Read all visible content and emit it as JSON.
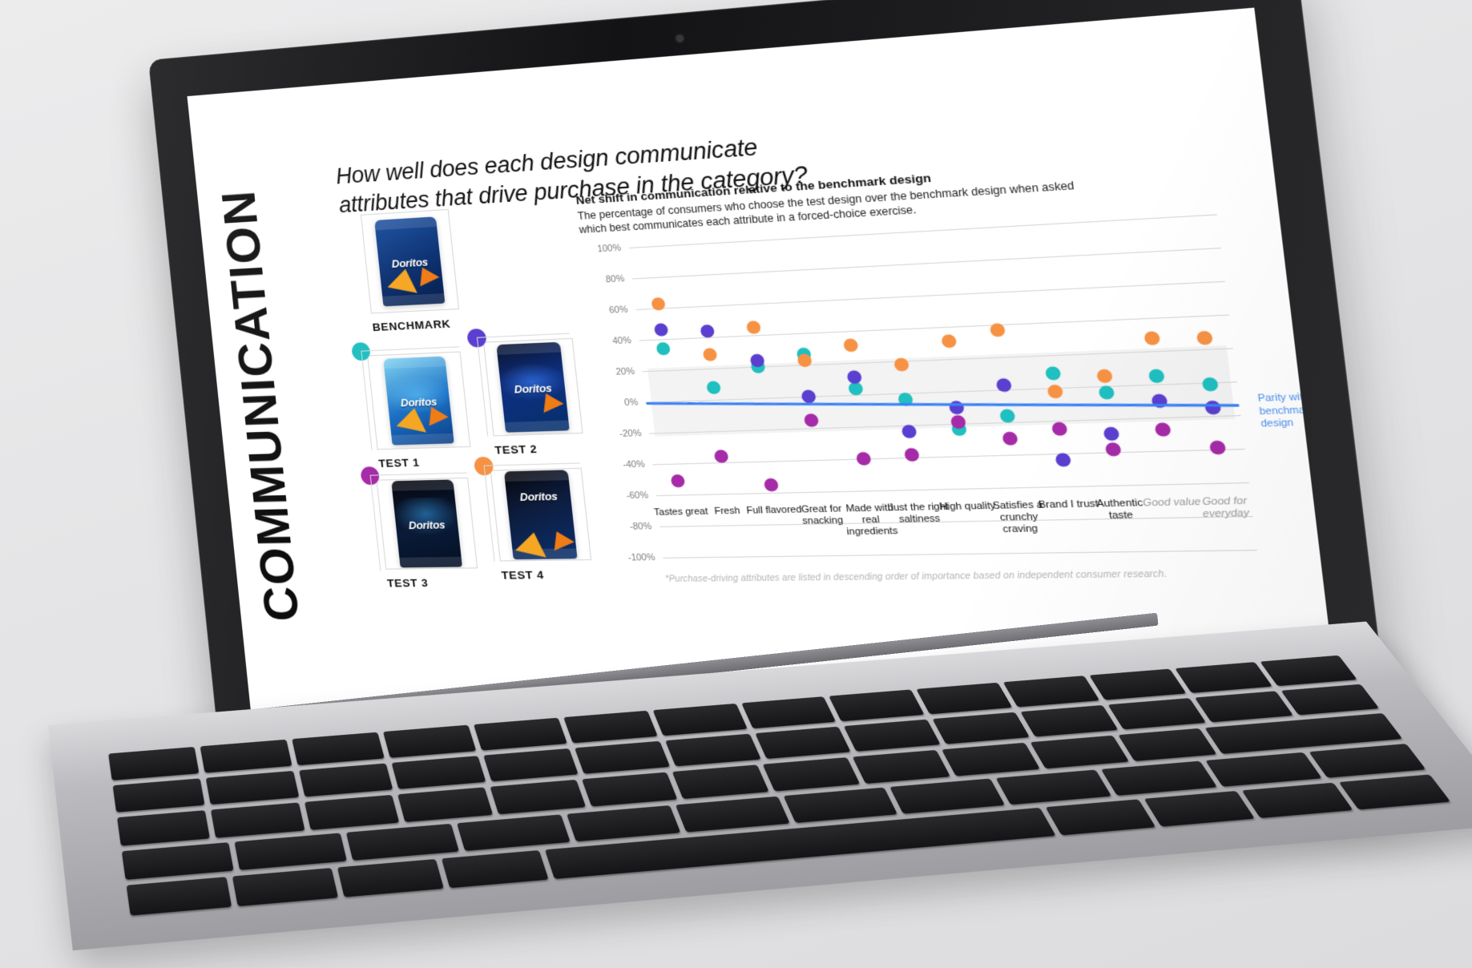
{
  "slide": {
    "vertical_title": "COMMUNICATION",
    "headline": "How well does each design communicate attributes that drive purchase in the category?"
  },
  "designs": {
    "benchmark": {
      "label": "BENCHMARK"
    },
    "tests": [
      {
        "label": "TEST 1",
        "color": "#20bfc0"
      },
      {
        "label": "TEST 2",
        "color": "#5b3fd0"
      },
      {
        "label": "TEST 3",
        "color": "#a62ba8"
      },
      {
        "label": "TEST 4",
        "color": "#f79244"
      }
    ]
  },
  "chart_meta": {
    "title": "Net shift in communication relative to the benchmark design",
    "subtitle": "The percentage of consumers who choose the test design over the benchmark design when asked which best communicates each attribute in a forced-choice exercise.",
    "parity_annotation": "Parity with benchmark design",
    "footnote": "*Purchase-driving attributes are listed in descending order of importance based on independent consumer research.",
    "dim_categories": [
      "Good value",
      "Good for everyday"
    ],
    "parity_color": "#3b82f6",
    "band_low": -22,
    "band_high": 22
  },
  "chart_data": {
    "type": "scatter",
    "title": "Net shift in communication relative to the benchmark design",
    "xlabel": "",
    "ylabel": "",
    "ylim": [
      -100,
      100
    ],
    "yticks": [
      "100%",
      "80%",
      "60%",
      "40%",
      "20%",
      "0%",
      "-20%",
      "-40%",
      "-60%",
      "-80%",
      "-100%"
    ],
    "ytick_values": [
      100,
      80,
      60,
      40,
      20,
      0,
      -20,
      -40,
      -60,
      -80,
      -100
    ],
    "grid": true,
    "legend_position": "left-panel",
    "categories": [
      "Tastes great",
      "Fresh",
      "Full flavored",
      "Great for snacking",
      "Made with real ingredients",
      "Just the right saltiness",
      "High quality",
      "Satisfies a crunchy craving",
      "Brand I trust",
      "Authentic taste",
      "Good value",
      "Good for everyday"
    ],
    "series": [
      {
        "name": "TEST 1",
        "color": "#20bfc0",
        "values": [
          34,
          8,
          20,
          27,
          4,
          -4,
          -23,
          -16,
          9,
          -4,
          5,
          -1
        ]
      },
      {
        "name": "TEST 2",
        "color": "#5b3fd0",
        "values": [
          46,
          44,
          24,
          0,
          11,
          -24,
          -10,
          3,
          -44,
          -29,
          -10,
          -15
        ]
      },
      {
        "name": "TEST 3",
        "color": "#a62ba8",
        "values": [
          -51,
          -36,
          -55,
          -15,
          -40,
          -38,
          -19,
          -30,
          -25,
          -38,
          -27,
          -39
        ]
      },
      {
        "name": "TEST 4",
        "color": "#f79244",
        "values": [
          63,
          29,
          45,
          23,
          31,
          18,
          31,
          37,
          -2,
          6,
          28,
          27
        ]
      }
    ],
    "parity_trendline": {
      "name": "Parity with benchmark design",
      "y_start": 0,
      "y_end": -14,
      "color": "#3b82f6"
    }
  }
}
